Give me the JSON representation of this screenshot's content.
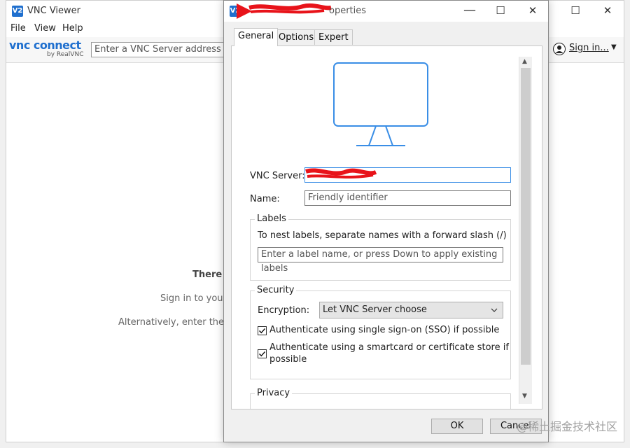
{
  "main_window": {
    "title": "VNC Viewer",
    "app_badge": "V2",
    "menu": [
      "File",
      "View",
      "Help"
    ],
    "logo_text": "vnc connect",
    "logo_sub": "by RealVNC",
    "address_placeholder": "Enter a VNC Server address or s",
    "sign_in_label": "Sign in...",
    "empty_heading": "There a",
    "empty_line1": "Sign in to your",
    "empty_line2": "Alternatively, enter the VN"
  },
  "dialog": {
    "title": "operties",
    "tabs": [
      "General",
      "Options",
      "Expert"
    ],
    "active_tab": "General",
    "vnc_server_label": "VNC Server:",
    "vnc_server_value": "",
    "name_label": "Name:",
    "name_placeholder": "Friendly identifier",
    "labels_group": {
      "title": "Labels",
      "hint": "To nest labels, separate names with a forward slash (/)",
      "input_placeholder": "Enter a label name, or press Down to apply existing labels"
    },
    "security_group": {
      "title": "Security",
      "encryption_label": "Encryption:",
      "encryption_value": "Let VNC Server choose",
      "sso_label": "Authenticate using single sign-on (SSO) if possible",
      "sso_checked": true,
      "smartcard_label_line1": "Authenticate using a smartcard or certificate store if",
      "smartcard_label_line2": "possible",
      "smartcard_checked": true
    },
    "privacy_group": {
      "title": "Privacy"
    },
    "ok_label": "OK",
    "cancel_label": "Cancel"
  },
  "watermark": "@稀土掘金技术社区",
  "colors": {
    "accent": "#1f6fce",
    "monitor_stroke": "#3a8ee6",
    "redaction": "#e8131a"
  }
}
